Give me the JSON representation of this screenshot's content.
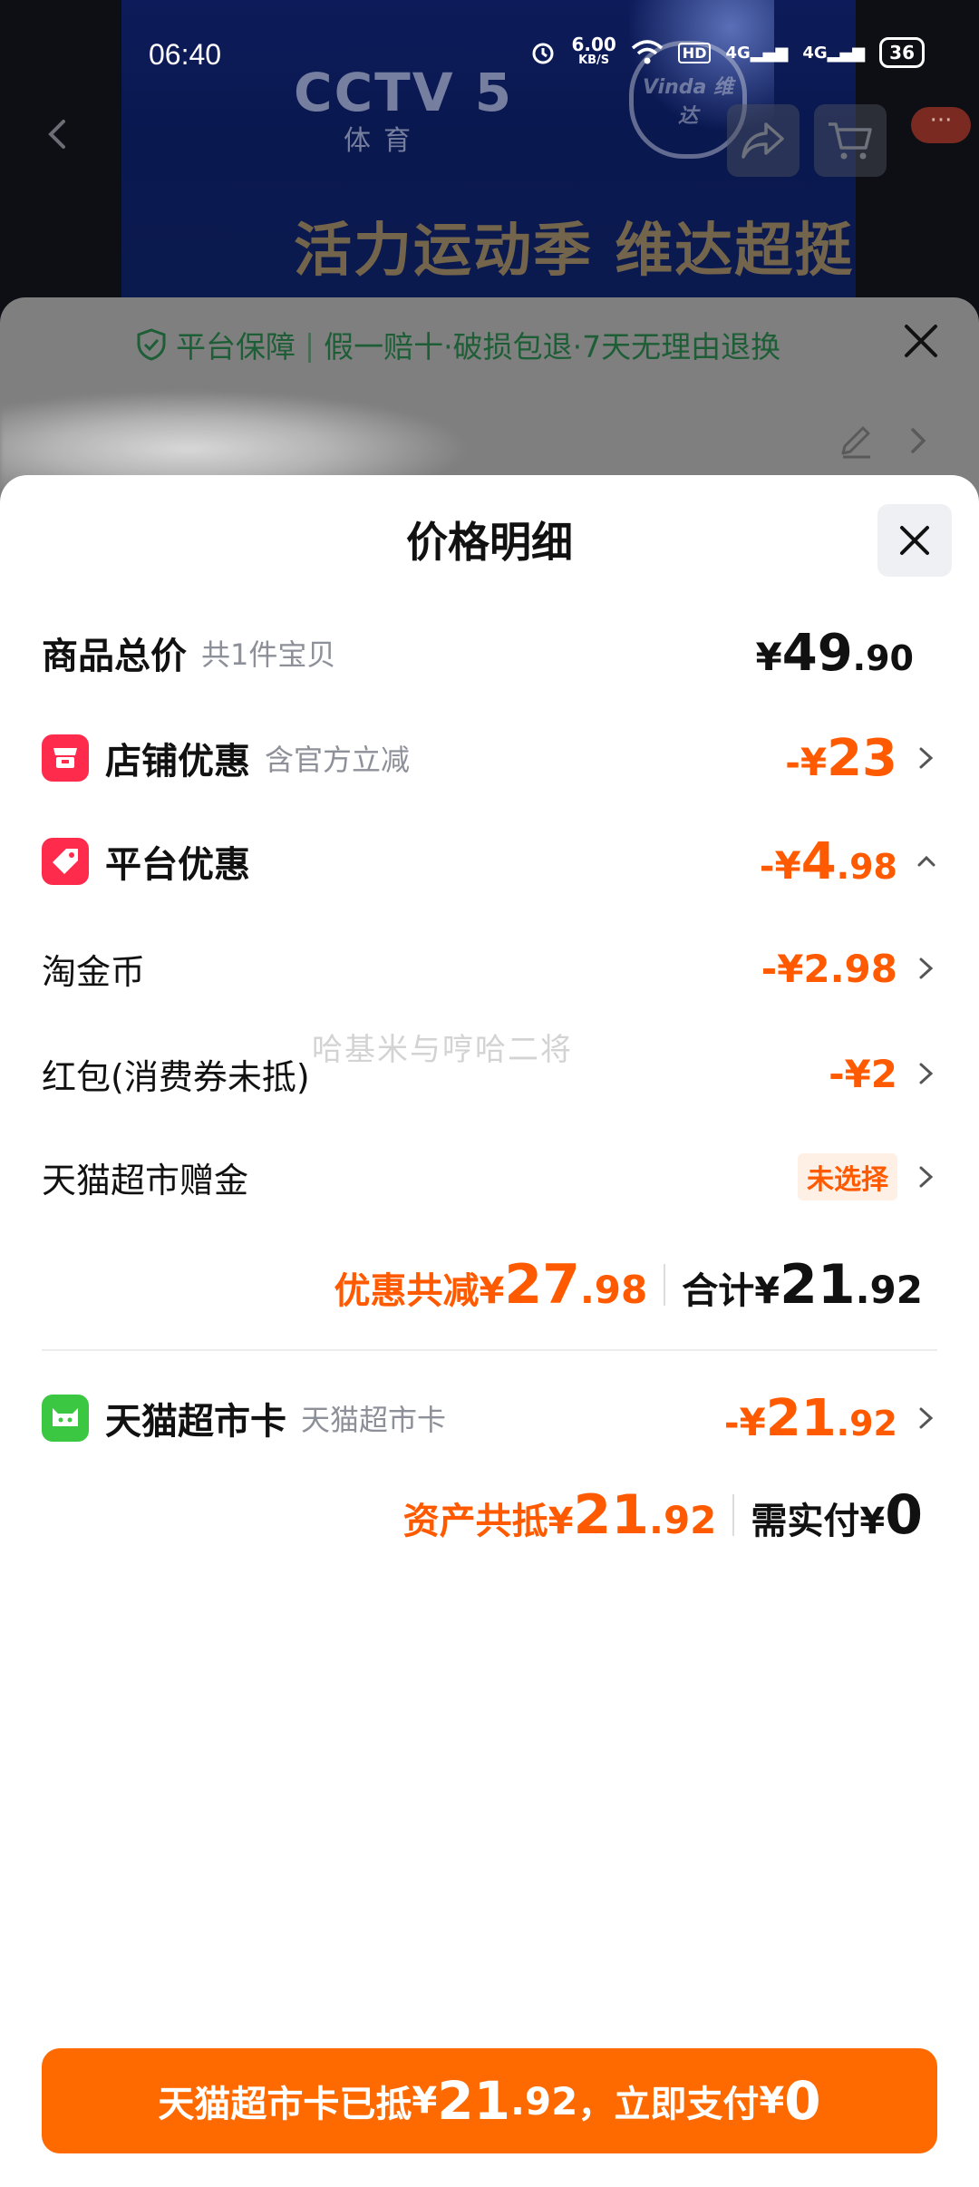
{
  "status": {
    "time": "06:40",
    "net_speed": "6.00\nKB/S",
    "net_speed_value": "6.00",
    "net_speed_unit": "KB/S",
    "signal1": "4G",
    "signal2": "4G",
    "battery": "36"
  },
  "banner": {
    "channel": "CCTV 5",
    "channel_sub": "体育",
    "brand": "Vinda 维达",
    "slogan": "活力运动季 维达超挺你"
  },
  "nav": {
    "more_label": "···"
  },
  "guarantee": {
    "title": "平台保障",
    "text": "假一赔十·破损包退·7天无理由退换"
  },
  "sheet": {
    "title": "价格明细",
    "total_label": "商品总价",
    "total_sub": "共1件宝贝",
    "total_yen": "¥",
    "total_int": "49",
    "total_dec": ".90",
    "store_label": "店铺优惠",
    "store_sub": "含官方立减",
    "store_minus": "-",
    "store_yen": "¥",
    "store_int": "23",
    "platform_label": "平台优惠",
    "platform_minus": "-",
    "platform_yen": "¥",
    "platform_int": "4",
    "platform_dec": ".98",
    "coin_label": "淘金币",
    "coin_amount": "-¥2.98",
    "redpack_label": "红包(消费券未抵)",
    "redpack_amount": "-¥2",
    "gift_label": "天猫超市赠金",
    "gift_status": "未选择",
    "discount_label": "优惠共减",
    "discount_yen": "¥",
    "discount_int": "27",
    "discount_dec": ".98",
    "subtotal_label": "合计",
    "subtotal_yen": "¥",
    "subtotal_int": "21",
    "subtotal_dec": ".92",
    "card_label": "天猫超市卡",
    "card_sub": "天猫超市卡",
    "card_minus": "-",
    "card_yen": "¥",
    "card_int": "21",
    "card_dec": ".92",
    "asset_label": "资产共抵",
    "asset_yen": "¥",
    "asset_int": "21",
    "asset_dec": ".92",
    "pay_label": "需实付",
    "pay_yen": "¥",
    "pay_int": "0",
    "watermark": "哈基米与哼哈二将"
  },
  "pay_button": {
    "prefix": "天猫超市卡已抵 ",
    "yen1": "¥",
    "amt_int": "21",
    "amt_dec": ".92",
    "middle": "，立即支付 ",
    "yen2": "¥",
    "pay_int": "0"
  },
  "colors": {
    "accent": "#ff5a00",
    "pay_button": "#ff6a00",
    "store_badge": "#ff2b4d",
    "card_badge": "#3cc742"
  }
}
